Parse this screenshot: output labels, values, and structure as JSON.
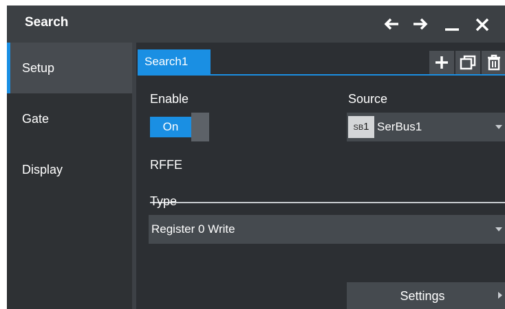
{
  "window": {
    "title": "Search",
    "controls": [
      "back-arrow-icon",
      "forward-arrow-icon",
      "minimize-icon",
      "close-icon"
    ]
  },
  "sidebar": {
    "items": [
      {
        "label": "Setup",
        "active": true
      },
      {
        "label": "Gate",
        "active": false
      },
      {
        "label": "Display",
        "active": false
      }
    ]
  },
  "main": {
    "tab": {
      "label": "Search1"
    },
    "tab_actions": [
      "plus-icon",
      "copy-icon",
      "trash-icon"
    ],
    "enable": {
      "label": "Enable",
      "state": "On"
    },
    "source": {
      "label": "Source",
      "badge_prefix": "SB",
      "badge_index": "1",
      "value": "SerBus1"
    },
    "section": "RFFE",
    "type": {
      "label": "Type",
      "value": "Register 0 Write"
    },
    "settings_label": "Settings"
  },
  "colors": {
    "accent": "#1a8fe3",
    "background": "#2c2f33",
    "titlebar": "#3c4044"
  }
}
